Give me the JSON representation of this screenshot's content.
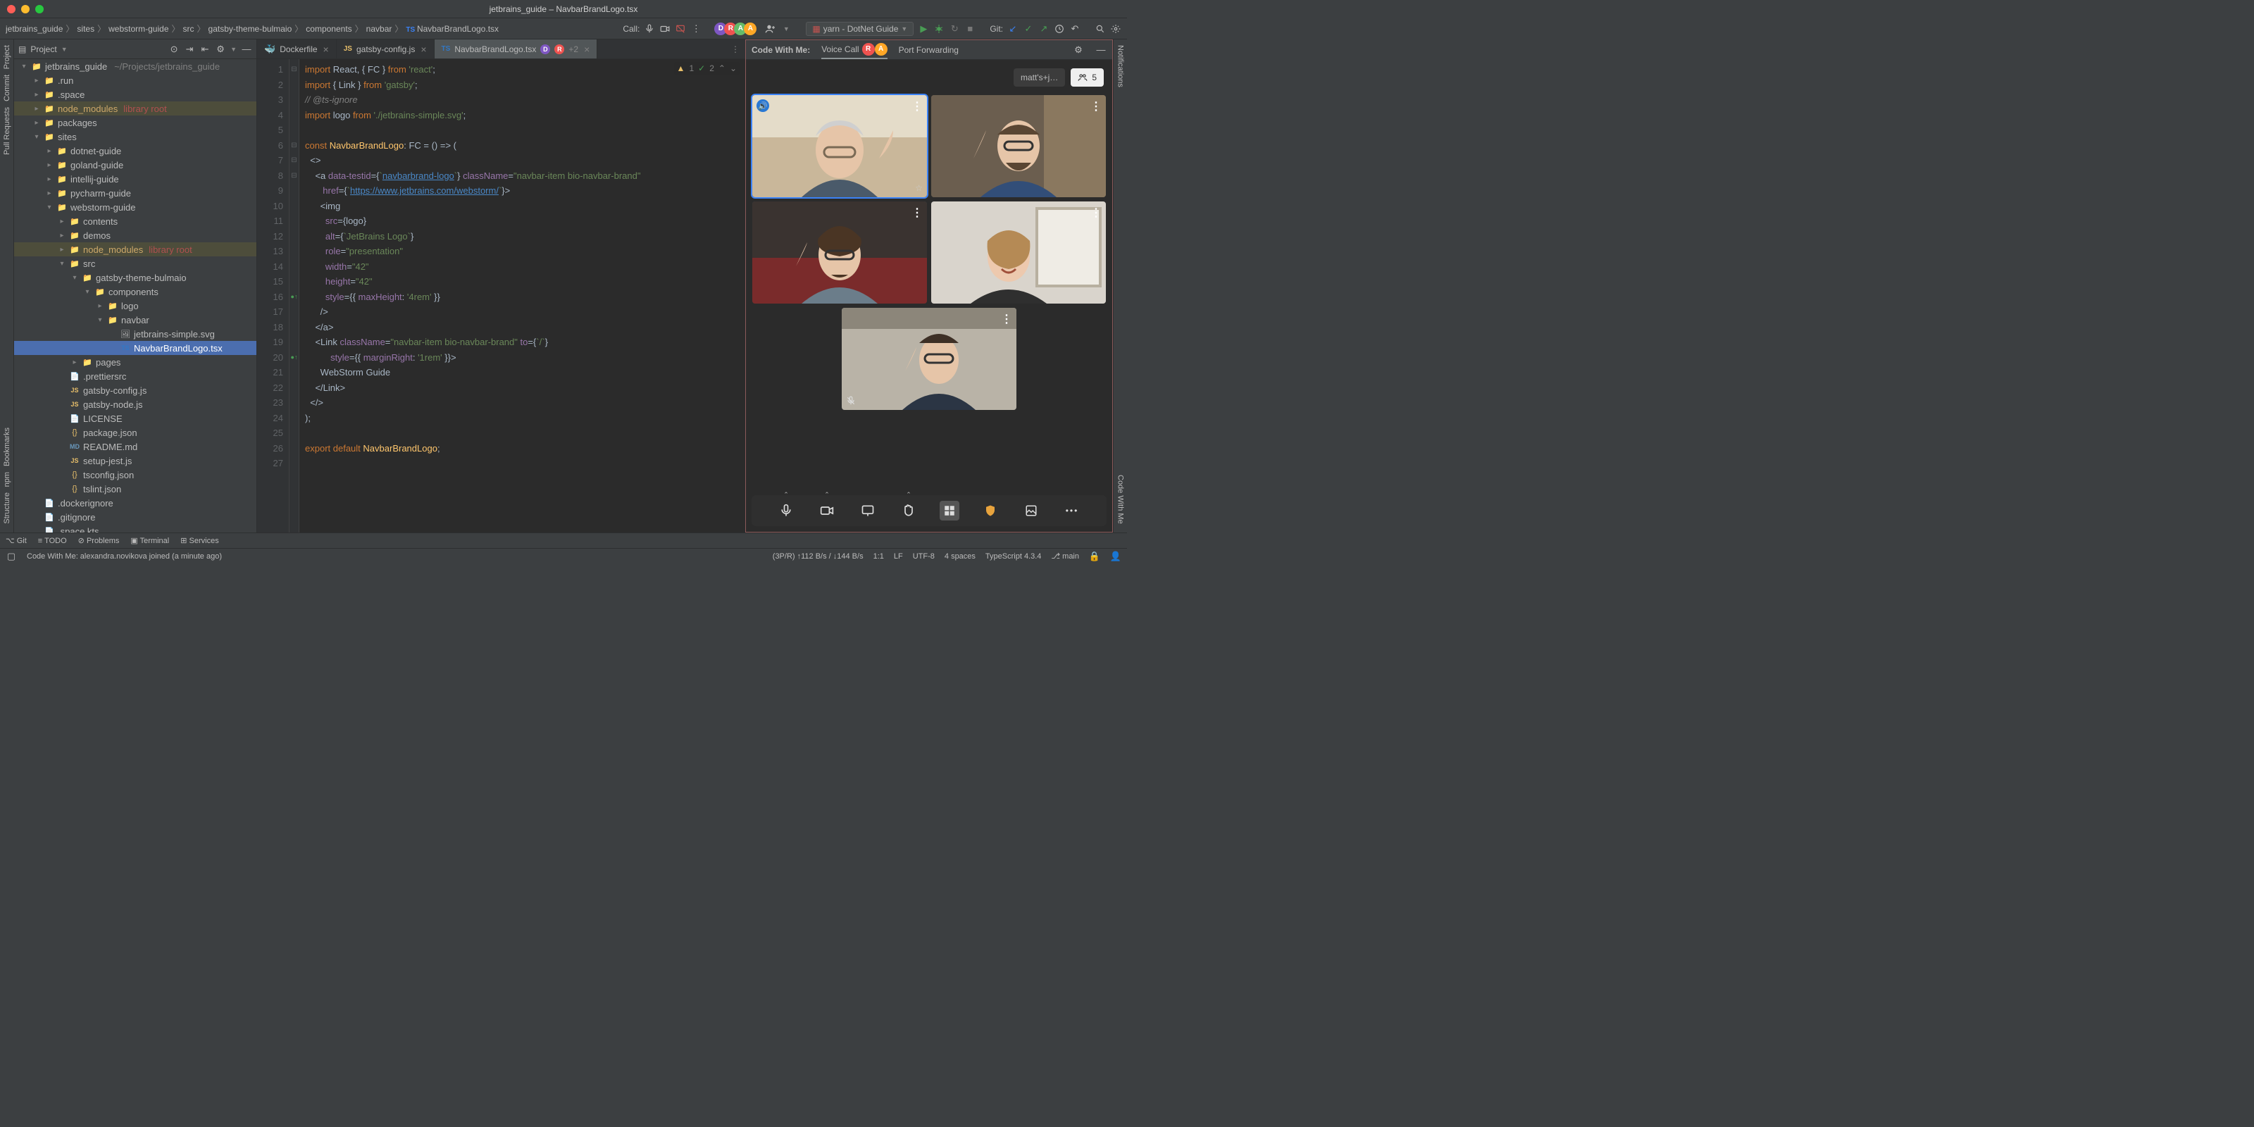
{
  "title": "jetbrains_guide – NavbarBrandLogo.tsx",
  "breadcrumbs": [
    "jetbrains_guide",
    "sites",
    "webstorm-guide",
    "src",
    "gatsby-theme-bulmaio",
    "components",
    "navbar",
    "NavbarBrandLogo.tsx"
  ],
  "callLabel": "Call:",
  "avatars": [
    {
      "letter": "D",
      "color": "#7e57c2"
    },
    {
      "letter": "R",
      "color": "#ef5350"
    },
    {
      "letter": "A",
      "color": "#66bb6a"
    },
    {
      "letter": "A",
      "color": "#ffa726"
    }
  ],
  "runConfig": "yarn - DotNet Guide",
  "gitLabel": "Git:",
  "projectTitle": "Project",
  "tree": [
    {
      "d": 0,
      "ar": "▾",
      "ico": "📁",
      "name": "jetbrains_guide",
      "dim": "~/Projects/jetbrains_guide"
    },
    {
      "d": 1,
      "ar": "▸",
      "ico": "📁",
      "name": ".run"
    },
    {
      "d": 1,
      "ar": "▸",
      "ico": "📁",
      "name": ".space"
    },
    {
      "d": 1,
      "ar": "▸",
      "ico": "📁",
      "name": "node_modules",
      "lib": "library root",
      "hl": true
    },
    {
      "d": 1,
      "ar": "▸",
      "ico": "📁",
      "name": "packages"
    },
    {
      "d": 1,
      "ar": "▾",
      "ico": "📁",
      "name": "sites"
    },
    {
      "d": 2,
      "ar": "▸",
      "ico": "📁",
      "name": "dotnet-guide"
    },
    {
      "d": 2,
      "ar": "▸",
      "ico": "📁",
      "name": "goland-guide"
    },
    {
      "d": 2,
      "ar": "▸",
      "ico": "📁",
      "name": "intellij-guide"
    },
    {
      "d": 2,
      "ar": "▸",
      "ico": "📁",
      "name": "pycharm-guide"
    },
    {
      "d": 2,
      "ar": "▾",
      "ico": "📁",
      "name": "webstorm-guide"
    },
    {
      "d": 3,
      "ar": "▸",
      "ico": "📁",
      "name": "contents"
    },
    {
      "d": 3,
      "ar": "▸",
      "ico": "📁",
      "name": "demos"
    },
    {
      "d": 3,
      "ar": "▸",
      "ico": "📁",
      "name": "node_modules",
      "lib": "library root",
      "hl": true
    },
    {
      "d": 3,
      "ar": "▾",
      "ico": "📁",
      "name": "src"
    },
    {
      "d": 4,
      "ar": "▾",
      "ico": "📁",
      "name": "gatsby-theme-bulmaio"
    },
    {
      "d": 5,
      "ar": "▾",
      "ico": "📁",
      "name": "components"
    },
    {
      "d": 6,
      "ar": "▸",
      "ico": "📁",
      "name": "logo"
    },
    {
      "d": 6,
      "ar": "▾",
      "ico": "📁",
      "name": "navbar"
    },
    {
      "d": 7,
      "ar": "",
      "ico": "🖼",
      "name": "jetbrains-simple.svg"
    },
    {
      "d": 7,
      "ar": "",
      "ico": "TS",
      "name": "NavbarBrandLogo.tsx",
      "sel": true
    },
    {
      "d": 4,
      "ar": "▸",
      "ico": "📁",
      "name": "pages"
    },
    {
      "d": 3,
      "ar": "",
      "ico": "📄",
      "name": ".prettiersrc"
    },
    {
      "d": 3,
      "ar": "",
      "ico": "JS",
      "name": "gatsby-config.js"
    },
    {
      "d": 3,
      "ar": "",
      "ico": "JS",
      "name": "gatsby-node.js"
    },
    {
      "d": 3,
      "ar": "",
      "ico": "📄",
      "name": "LICENSE"
    },
    {
      "d": 3,
      "ar": "",
      "ico": "{}",
      "name": "package.json"
    },
    {
      "d": 3,
      "ar": "",
      "ico": "MD",
      "name": "README.md"
    },
    {
      "d": 3,
      "ar": "",
      "ico": "JS",
      "name": "setup-jest.js"
    },
    {
      "d": 3,
      "ar": "",
      "ico": "{}",
      "name": "tsconfig.json"
    },
    {
      "d": 3,
      "ar": "",
      "ico": "{}",
      "name": "tslint.json"
    },
    {
      "d": 1,
      "ar": "",
      "ico": "📄",
      "name": ".dockerignore"
    },
    {
      "d": 1,
      "ar": "",
      "ico": "📄",
      "name": ".gitignore"
    },
    {
      "d": 1,
      "ar": "",
      "ico": "📄",
      "name": ".space.kts"
    }
  ],
  "tabs": [
    {
      "label": "Dockerfile",
      "ico": "🐳"
    },
    {
      "label": "gatsby-config.js",
      "ico": "JS"
    },
    {
      "label": "NavbarBrandLogo.tsx",
      "ico": "TS",
      "active": true,
      "badges": [
        "D",
        "R"
      ],
      "extra": "+2"
    }
  ],
  "inspections": {
    "warn": "1",
    "ok": "2"
  },
  "code": [
    {
      "n": 1,
      "fold": "⊟",
      "html": "<span class='kw'>import</span><span class='txt'> React, { FC } </span><span class='kw'>from</span><span class='str'> 'react'</span><span class='txt'>;</span>"
    },
    {
      "n": 2,
      "fold": "",
      "html": "<span class='kw'>import</span><span class='txt'> { Link } </span><span class='kw'>from</span><span class='str'> 'gatsby'</span><span class='txt'>;</span>"
    },
    {
      "n": 3,
      "fold": "",
      "html": "<span class='cm'>// @ts-ignore</span>"
    },
    {
      "n": 4,
      "fold": "",
      "html": "<span class='kw'>import</span><span class='txt'> logo </span><span class='kw'>from</span><span class='str'> './jetbrains-simple.svg'</span><span class='txt'>;</span>"
    },
    {
      "n": 5,
      "fold": "",
      "html": ""
    },
    {
      "n": 6,
      "fold": "⊟",
      "html": "<span class='kw'>const</span><span class='txt'> </span><span class='fn'>NavbarBrandLogo</span><span class='txt'>: FC = () =&gt; (</span>"
    },
    {
      "n": 7,
      "fold": "⊟",
      "html": "<span class='txt'>  &lt;&gt;</span>"
    },
    {
      "n": 8,
      "fold": "⊟",
      "html": "<span class='txt'>    &lt;a </span><span class='pr'>data-testid</span><span class='txt'>={</span><span class='str'>`</span><span class='lnk'>navbarbrand-logo</span><span class='str'>`</span><span class='txt'>} </span><span class='pr'>className</span><span class='txt'>=</span><span class='str'>\"navbar-item bio-navbar-brand\"</span>"
    },
    {
      "n": 9,
      "fold": "",
      "html": "<span class='txt'>       </span><span class='pr'>href</span><span class='txt'>={</span><span class='str'>`</span><span class='lnk'>https://www.jetbrains.com/webstorm/</span><span class='str'>`</span><span class='txt'>}&gt;</span>"
    },
    {
      "n": 10,
      "fold": "",
      "html": "<span class='txt'>      &lt;img</span>"
    },
    {
      "n": 11,
      "fold": "",
      "html": "<span class='txt'>        </span><span class='pr'>src</span><span class='txt'>={logo}</span>"
    },
    {
      "n": 12,
      "fold": "",
      "html": "<span class='txt'>        </span><span class='pr'>alt</span><span class='txt'>={</span><span class='str'>`JetBrains Logo`</span><span class='txt'>}</span>"
    },
    {
      "n": 13,
      "fold": "",
      "html": "<span class='txt'>        </span><span class='pr'>role</span><span class='txt'>=</span><span class='str'>\"presentation\"</span>"
    },
    {
      "n": 14,
      "fold": "",
      "html": "<span class='txt'>        </span><span class='pr'>width</span><span class='txt'>=</span><span class='str'>\"42\"</span>"
    },
    {
      "n": 15,
      "fold": "",
      "html": "<span class='txt'>        </span><span class='pr'>height</span><span class='txt'>=</span><span class='str'>\"42\"</span>"
    },
    {
      "n": 16,
      "fold": "",
      "mark": "●↑",
      "html": "<span class='txt'>        </span><span class='pr'>style</span><span class='txt'>={{ </span><span class='pr'>maxHeight</span><span class='txt'>: </span><span class='str'>'4rem'</span><span class='txt'> }}</span>"
    },
    {
      "n": 17,
      "fold": "",
      "html": "<span class='txt'>      /&gt;</span>"
    },
    {
      "n": 18,
      "fold": "",
      "html": "<span class='txt'>    &lt;/a&gt;</span>"
    },
    {
      "n": 19,
      "fold": "",
      "html": "<span class='txt'>    &lt;Link </span><span class='pr'>className</span><span class='txt'>=</span><span class='str'>\"navbar-item bio-navbar-brand\"</span><span class='txt'> </span><span class='pr'>to</span><span class='txt'>={</span><span class='str'>`/`</span><span class='txt'>}</span>"
    },
    {
      "n": 20,
      "fold": "⊟",
      "mark": "●↑",
      "html": "<span class='txt'>          </span><span class='pr'>style</span><span class='txt'>={{ </span><span class='pr'>marginRight</span><span class='txt'>: </span><span class='str'>'1rem'</span><span class='txt'> }}&gt;</span>"
    },
    {
      "n": 21,
      "fold": "",
      "html": "<span class='txt'>      WebStorm Guide</span>"
    },
    {
      "n": 22,
      "fold": "",
      "html": "<span class='txt'>    &lt;/Link&gt;</span>"
    },
    {
      "n": 23,
      "fold": "",
      "html": "<span class='txt'>  &lt;/&gt;</span>"
    },
    {
      "n": 24,
      "fold": "",
      "html": "<span class='txt'>);</span>"
    },
    {
      "n": 25,
      "fold": "",
      "html": ""
    },
    {
      "n": 26,
      "fold": "",
      "html": "<span class='kw'>export default</span><span class='txt'> </span><span class='fn'>NavbarBrandLogo</span><span class='txt'>;</span>"
    },
    {
      "n": 27,
      "fold": "",
      "html": ""
    }
  ],
  "cwm": {
    "tabs": [
      "Code With Me:",
      "Voice Call",
      "Port Forwarding"
    ],
    "voiceBadges": [
      "R",
      "A"
    ],
    "callParticipant": "matt's+j…",
    "count": "5"
  },
  "bottomTools": [
    "Git",
    "TODO",
    "Problems",
    "Terminal",
    "Services"
  ],
  "status": {
    "msg": "Code With Me: alexandra.novikova joined (a minute ago)",
    "net": "(3P/R) ↑112 B/s / ↓144 B/s",
    "pos": "1:1",
    "lf": "LF",
    "enc": "UTF-8",
    "indent": "4 spaces",
    "lang": "TypeScript 4.3.4",
    "branch": "main"
  },
  "leftStripe": [
    "Project",
    "Commit",
    "Pull Requests"
  ],
  "leftStripeBottom": [
    "Bookmarks",
    "npm",
    "Structure"
  ],
  "rightStripe": [
    "Notifications"
  ],
  "rightStripeBottom": [
    "Code With Me"
  ]
}
